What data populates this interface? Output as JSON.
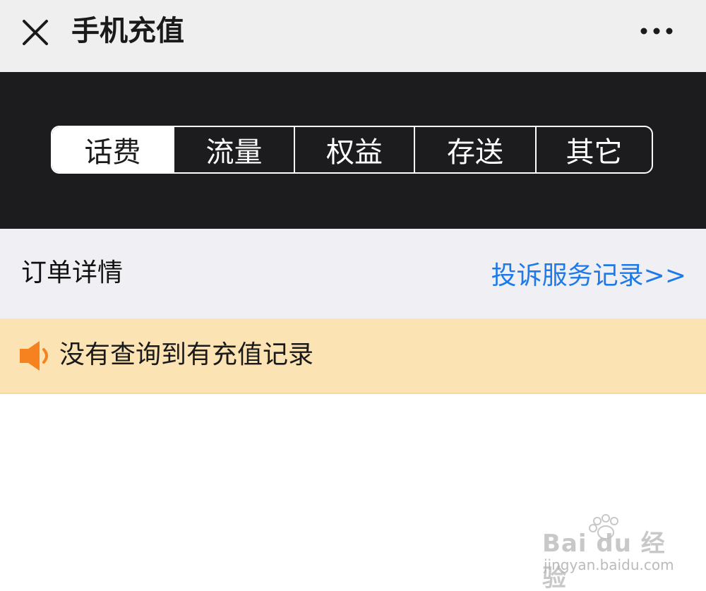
{
  "titlebar": {
    "title": "手机充值",
    "close_icon": "close-icon",
    "more_icon": "more-icon"
  },
  "tabs": [
    {
      "label": "话费",
      "active": true
    },
    {
      "label": "流量",
      "active": false
    },
    {
      "label": "权益",
      "active": false
    },
    {
      "label": "存送",
      "active": false
    },
    {
      "label": "其它",
      "active": false
    }
  ],
  "order": {
    "title": "订单详情",
    "complaint_link": "投诉服务记录>>"
  },
  "notice": {
    "icon": "speaker-icon",
    "text": "没有查询到有充值记录"
  },
  "watermark": {
    "brand": "Bai du 经验",
    "url": "jingyan.baidu.com"
  },
  "colors": {
    "titlebar_bg": "#efefef",
    "tab_band_bg": "#1c1c1f",
    "link": "#1e7ae8",
    "notice_bg": "#fce3b3",
    "speaker": "#f5821f"
  }
}
